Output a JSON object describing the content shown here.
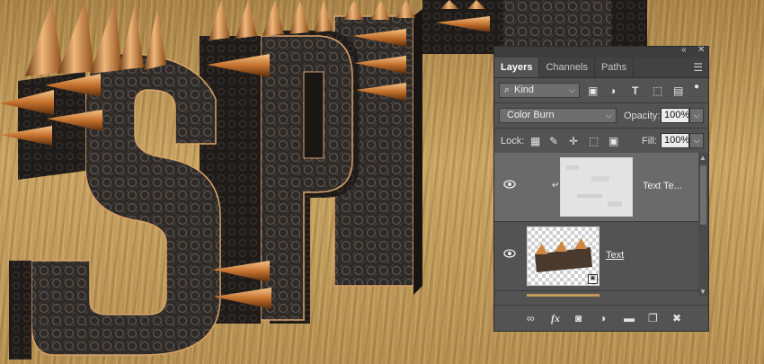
{
  "panel": {
    "tabs": [
      {
        "label": "Layers",
        "active": true
      },
      {
        "label": "Channels",
        "active": false
      },
      {
        "label": "Paths",
        "active": false
      }
    ],
    "filter": {
      "label": "Kind"
    },
    "filter_icons": [
      "image-filter-icon",
      "adjustment-filter-icon",
      "type-filter-icon",
      "shape-filter-icon",
      "smart-object-filter-icon"
    ],
    "blend_mode": "Color Burn",
    "opacity": {
      "label": "Opacity:",
      "value": "100%"
    },
    "lock": {
      "label": "Lock:"
    },
    "fill": {
      "label": "Fill:",
      "value": "100%"
    },
    "layers": [
      {
        "name": "Text Te...",
        "selected": true,
        "clipped": true
      },
      {
        "name": "Text",
        "selected": false,
        "clipped": false
      }
    ],
    "footer_icons": [
      "link-icon",
      "fx-icon",
      "mask-icon",
      "adjustment-icon",
      "group-folder-icon",
      "new-layer-icon",
      "trash-icon"
    ]
  },
  "artwork": {
    "letters": [
      "S",
      "P",
      "I",
      "K",
      "Y"
    ]
  },
  "colors": {
    "panel_bg": "#535353",
    "selected_layer": "#6a6a6a",
    "spike_copper": "#c8722a"
  }
}
